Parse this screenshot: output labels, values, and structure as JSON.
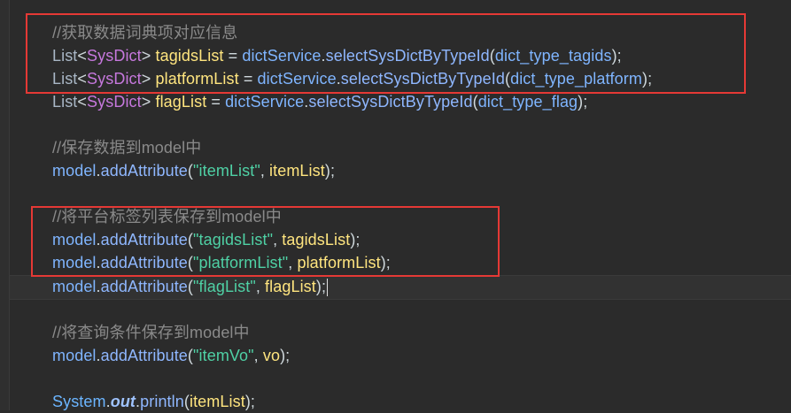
{
  "editor": {
    "lines": [
      {
        "id": "l1",
        "tokens": [
          {
            "t": "//获取数据词典项对应信息",
            "k": "comment"
          }
        ]
      },
      {
        "id": "l2",
        "tokens": [
          {
            "t": "List",
            "k": "type"
          },
          {
            "t": "<",
            "k": "plain"
          },
          {
            "t": "SysDict",
            "k": "generic"
          },
          {
            "t": "> ",
            "k": "plain"
          },
          {
            "t": "tagidsList",
            "k": "var"
          },
          {
            "t": " = ",
            "k": "plain"
          },
          {
            "t": "dictService",
            "k": "field"
          },
          {
            "t": ".",
            "k": "plain"
          },
          {
            "t": "selectSysDictByTypeId",
            "k": "method"
          },
          {
            "t": "(",
            "k": "plain"
          },
          {
            "t": "dict_type_tagids",
            "k": "field"
          },
          {
            "t": ");",
            "k": "plain"
          }
        ]
      },
      {
        "id": "l3",
        "tokens": [
          {
            "t": "List",
            "k": "type"
          },
          {
            "t": "<",
            "k": "plain"
          },
          {
            "t": "SysDict",
            "k": "generic"
          },
          {
            "t": "> ",
            "k": "plain"
          },
          {
            "t": "platformList",
            "k": "var"
          },
          {
            "t": " = ",
            "k": "plain"
          },
          {
            "t": "dictService",
            "k": "field"
          },
          {
            "t": ".",
            "k": "plain"
          },
          {
            "t": "selectSysDictByTypeId",
            "k": "method"
          },
          {
            "t": "(",
            "k": "plain"
          },
          {
            "t": "dict_type_platform",
            "k": "field"
          },
          {
            "t": ");",
            "k": "plain"
          }
        ]
      },
      {
        "id": "l4",
        "tokens": [
          {
            "t": "List",
            "k": "type"
          },
          {
            "t": "<",
            "k": "plain"
          },
          {
            "t": "SysDict",
            "k": "generic"
          },
          {
            "t": "> ",
            "k": "plain"
          },
          {
            "t": "flagList",
            "k": "var"
          },
          {
            "t": " = ",
            "k": "plain"
          },
          {
            "t": "dictService",
            "k": "field"
          },
          {
            "t": ".",
            "k": "plain"
          },
          {
            "t": "selectSysDictByTypeId",
            "k": "method"
          },
          {
            "t": "(",
            "k": "plain"
          },
          {
            "t": "dict_type_flag",
            "k": "field"
          },
          {
            "t": ");",
            "k": "plain"
          }
        ]
      },
      {
        "id": "l5",
        "tokens": []
      },
      {
        "id": "l6",
        "tokens": [
          {
            "t": "//保存数据到model中",
            "k": "comment"
          }
        ]
      },
      {
        "id": "l7",
        "tokens": [
          {
            "t": "model",
            "k": "field"
          },
          {
            "t": ".",
            "k": "plain"
          },
          {
            "t": "addAttribute",
            "k": "method"
          },
          {
            "t": "(",
            "k": "plain"
          },
          {
            "t": "\"itemList\"",
            "k": "string"
          },
          {
            "t": ", ",
            "k": "plain"
          },
          {
            "t": "itemList",
            "k": "var"
          },
          {
            "t": ");",
            "k": "plain"
          }
        ]
      },
      {
        "id": "l8",
        "tokens": []
      },
      {
        "id": "l9",
        "tokens": [
          {
            "t": "//将平台标签列表保存到model中",
            "k": "comment"
          }
        ]
      },
      {
        "id": "l10",
        "tokens": [
          {
            "t": "model",
            "k": "field"
          },
          {
            "t": ".",
            "k": "plain"
          },
          {
            "t": "addAttribute",
            "k": "method"
          },
          {
            "t": "(",
            "k": "plain"
          },
          {
            "t": "\"tagidsList\"",
            "k": "string"
          },
          {
            "t": ", ",
            "k": "plain"
          },
          {
            "t": "tagidsList",
            "k": "var"
          },
          {
            "t": ");",
            "k": "plain"
          }
        ]
      },
      {
        "id": "l11",
        "tokens": [
          {
            "t": "model",
            "k": "field"
          },
          {
            "t": ".",
            "k": "plain"
          },
          {
            "t": "addAttribute",
            "k": "method"
          },
          {
            "t": "(",
            "k": "plain"
          },
          {
            "t": "\"platformList\"",
            "k": "string"
          },
          {
            "t": ", ",
            "k": "plain"
          },
          {
            "t": "platformList",
            "k": "var"
          },
          {
            "t": ");",
            "k": "plain"
          }
        ]
      },
      {
        "id": "l12",
        "tokens": [
          {
            "t": "model",
            "k": "field"
          },
          {
            "t": ".",
            "k": "plain"
          },
          {
            "t": "addAttribute",
            "k": "method"
          },
          {
            "t": "(",
            "k": "plain"
          },
          {
            "t": "\"flagList\"",
            "k": "string"
          },
          {
            "t": ", ",
            "k": "plain"
          },
          {
            "t": "flagList",
            "k": "var"
          },
          {
            "t": ");",
            "k": "plain"
          }
        ],
        "caret": true
      },
      {
        "id": "l13",
        "tokens": []
      },
      {
        "id": "l14",
        "tokens": [
          {
            "t": "//将查询条件保存到model中",
            "k": "comment"
          }
        ]
      },
      {
        "id": "l15",
        "tokens": [
          {
            "t": "model",
            "k": "field"
          },
          {
            "t": ".",
            "k": "plain"
          },
          {
            "t": "addAttribute",
            "k": "method"
          },
          {
            "t": "(",
            "k": "plain"
          },
          {
            "t": "\"itemVo\"",
            "k": "string"
          },
          {
            "t": ", ",
            "k": "plain"
          },
          {
            "t": "vo",
            "k": "var"
          },
          {
            "t": ");",
            "k": "plain"
          }
        ]
      },
      {
        "id": "l16",
        "tokens": []
      },
      {
        "id": "l17",
        "tokens": [
          {
            "t": "System",
            "k": "class"
          },
          {
            "t": ".",
            "k": "plain"
          },
          {
            "t": "out",
            "k": "static"
          },
          {
            "t": ".",
            "k": "plain"
          },
          {
            "t": "println",
            "k": "method"
          },
          {
            "t": "(",
            "k": "plain"
          },
          {
            "t": "itemList",
            "k": "var"
          },
          {
            "t": ");",
            "k": "plain"
          }
        ]
      }
    ]
  },
  "colors": {
    "background": "#2b2b2b",
    "annotation_box": "#e53935"
  }
}
